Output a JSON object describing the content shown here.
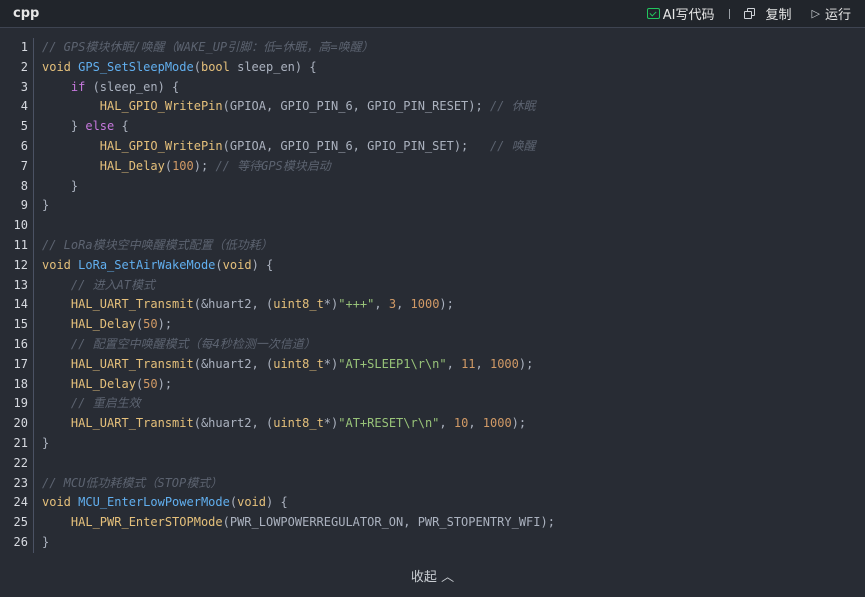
{
  "header": {
    "language": "cpp",
    "ai_label": "AI写代码",
    "copy_label": "复制",
    "run_label": "运行"
  },
  "code": {
    "lines": [
      [
        {
          "t": "c",
          "v": "// GPS模块休眠/唤醒（WAKE_UP引脚：低=休眠，高=唤醒）"
        }
      ],
      [
        {
          "t": "t",
          "v": "void"
        },
        {
          "t": "p",
          "v": " "
        },
        {
          "t": "f",
          "v": "GPS_SetSleepMode"
        },
        {
          "t": "p",
          "v": "("
        },
        {
          "t": "t",
          "v": "bool"
        },
        {
          "t": "p",
          "v": " sleep_en) {"
        }
      ],
      [
        {
          "t": "p",
          "v": "    "
        },
        {
          "t": "k",
          "v": "if"
        },
        {
          "t": "p",
          "v": " (sleep_en) {"
        }
      ],
      [
        {
          "t": "p",
          "v": "        "
        },
        {
          "t": "h",
          "v": "HAL_GPIO_WritePin"
        },
        {
          "t": "p",
          "v": "(GPIOA, GPIO_PIN_6, GPIO_PIN_RESET); "
        },
        {
          "t": "c",
          "v": "// 休眠"
        }
      ],
      [
        {
          "t": "p",
          "v": "    } "
        },
        {
          "t": "k",
          "v": "else"
        },
        {
          "t": "p",
          "v": " {"
        }
      ],
      [
        {
          "t": "p",
          "v": "        "
        },
        {
          "t": "h",
          "v": "HAL_GPIO_WritePin"
        },
        {
          "t": "p",
          "v": "(GPIOA, GPIO_PIN_6, GPIO_PIN_SET);   "
        },
        {
          "t": "c",
          "v": "// 唤醒"
        }
      ],
      [
        {
          "t": "p",
          "v": "        "
        },
        {
          "t": "h",
          "v": "HAL_Delay"
        },
        {
          "t": "p",
          "v": "("
        },
        {
          "t": "n",
          "v": "100"
        },
        {
          "t": "p",
          "v": "); "
        },
        {
          "t": "c",
          "v": "// 等待GPS模块启动"
        }
      ],
      [
        {
          "t": "p",
          "v": "    }"
        }
      ],
      [
        {
          "t": "p",
          "v": "}"
        }
      ],
      [
        {
          "t": "p",
          "v": ""
        }
      ],
      [
        {
          "t": "c",
          "v": "// LoRa模块空中唤醒模式配置（低功耗）"
        }
      ],
      [
        {
          "t": "t",
          "v": "void"
        },
        {
          "t": "p",
          "v": " "
        },
        {
          "t": "f",
          "v": "LoRa_SetAirWakeMode"
        },
        {
          "t": "p",
          "v": "("
        },
        {
          "t": "t",
          "v": "void"
        },
        {
          "t": "p",
          "v": ") {"
        }
      ],
      [
        {
          "t": "p",
          "v": "    "
        },
        {
          "t": "c",
          "v": "// 进入AT模式"
        }
      ],
      [
        {
          "t": "p",
          "v": "    "
        },
        {
          "t": "h",
          "v": "HAL_UART_Transmit"
        },
        {
          "t": "p",
          "v": "(&huart2, ("
        },
        {
          "t": "t",
          "v": "uint8_t"
        },
        {
          "t": "p",
          "v": "*)"
        },
        {
          "t": "s",
          "v": "\"+++\""
        },
        {
          "t": "p",
          "v": ", "
        },
        {
          "t": "n",
          "v": "3"
        },
        {
          "t": "p",
          "v": ", "
        },
        {
          "t": "n",
          "v": "1000"
        },
        {
          "t": "p",
          "v": ");"
        }
      ],
      [
        {
          "t": "p",
          "v": "    "
        },
        {
          "t": "h",
          "v": "HAL_Delay"
        },
        {
          "t": "p",
          "v": "("
        },
        {
          "t": "n",
          "v": "50"
        },
        {
          "t": "p",
          "v": ");"
        }
      ],
      [
        {
          "t": "p",
          "v": "    "
        },
        {
          "t": "c",
          "v": "// 配置空中唤醒模式（每4秒检测一次信道）"
        }
      ],
      [
        {
          "t": "p",
          "v": "    "
        },
        {
          "t": "h",
          "v": "HAL_UART_Transmit"
        },
        {
          "t": "p",
          "v": "(&huart2, ("
        },
        {
          "t": "t",
          "v": "uint8_t"
        },
        {
          "t": "p",
          "v": "*)"
        },
        {
          "t": "s",
          "v": "\"AT+SLEEP1\\r\\n\""
        },
        {
          "t": "p",
          "v": ", "
        },
        {
          "t": "n",
          "v": "11"
        },
        {
          "t": "p",
          "v": ", "
        },
        {
          "t": "n",
          "v": "1000"
        },
        {
          "t": "p",
          "v": ");"
        }
      ],
      [
        {
          "t": "p",
          "v": "    "
        },
        {
          "t": "h",
          "v": "HAL_Delay"
        },
        {
          "t": "p",
          "v": "("
        },
        {
          "t": "n",
          "v": "50"
        },
        {
          "t": "p",
          "v": ");"
        }
      ],
      [
        {
          "t": "p",
          "v": "    "
        },
        {
          "t": "c",
          "v": "// 重启生效"
        }
      ],
      [
        {
          "t": "p",
          "v": "    "
        },
        {
          "t": "h",
          "v": "HAL_UART_Transmit"
        },
        {
          "t": "p",
          "v": "(&huart2, ("
        },
        {
          "t": "t",
          "v": "uint8_t"
        },
        {
          "t": "p",
          "v": "*)"
        },
        {
          "t": "s",
          "v": "\"AT+RESET\\r\\n\""
        },
        {
          "t": "p",
          "v": ", "
        },
        {
          "t": "n",
          "v": "10"
        },
        {
          "t": "p",
          "v": ", "
        },
        {
          "t": "n",
          "v": "1000"
        },
        {
          "t": "p",
          "v": ");"
        }
      ],
      [
        {
          "t": "p",
          "v": "}"
        }
      ],
      [
        {
          "t": "p",
          "v": ""
        }
      ],
      [
        {
          "t": "c",
          "v": "// MCU低功耗模式（STOP模式）"
        }
      ],
      [
        {
          "t": "t",
          "v": "void"
        },
        {
          "t": "p",
          "v": " "
        },
        {
          "t": "f",
          "v": "MCU_EnterLowPowerMode"
        },
        {
          "t": "p",
          "v": "("
        },
        {
          "t": "t",
          "v": "void"
        },
        {
          "t": "p",
          "v": ") {"
        }
      ],
      [
        {
          "t": "p",
          "v": "    "
        },
        {
          "t": "h",
          "v": "HAL_PWR_EnterSTOPMode"
        },
        {
          "t": "p",
          "v": "(PWR_LOWPOWERREGULATOR_ON, PWR_STOPENTRY_WFI);"
        }
      ],
      [
        {
          "t": "p",
          "v": "}"
        }
      ]
    ]
  },
  "footer": {
    "collapse_label": "收起",
    "collapse_icon": "chevron-up-icon"
  },
  "colors": {
    "background": "#282c34",
    "header_background": "#21252b",
    "comment": "#5c6370",
    "keyword": "#c678dd",
    "type": "#e5c07b",
    "function": "#61afef",
    "number": "#d19a66",
    "string": "#98c379",
    "ai_icon": "#22c55e"
  }
}
